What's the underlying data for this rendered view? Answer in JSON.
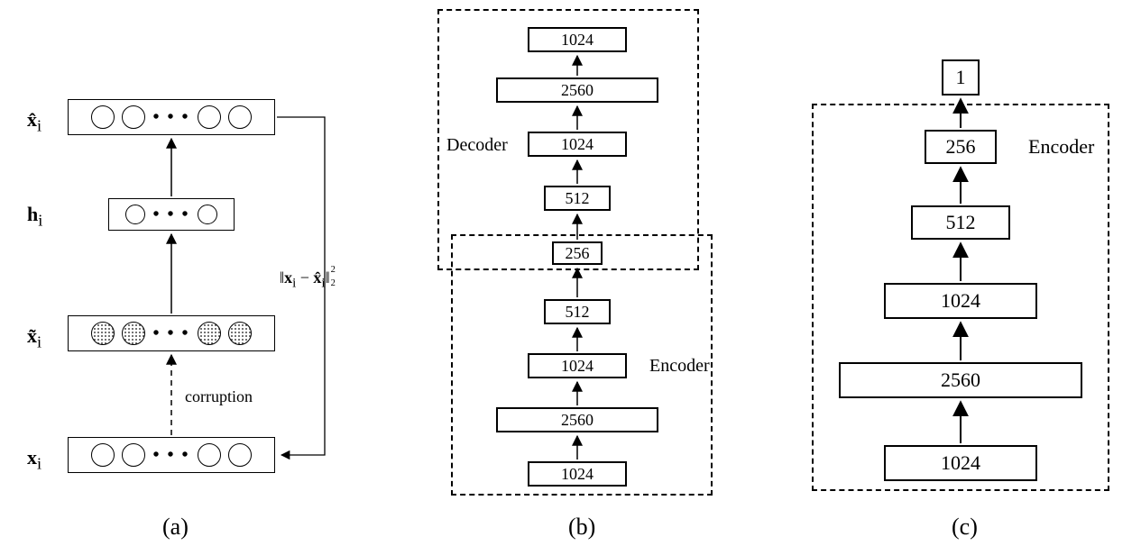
{
  "captions": {
    "a": "(a)",
    "b": "(b)",
    "c": "(c)"
  },
  "panel_a": {
    "label_x": "x",
    "label_xtilde": "x̃",
    "label_h": "h",
    "label_xhat": "x̂",
    "subscript": "i",
    "corruption": "corruption",
    "loss_prefix": "‖",
    "loss_mid": " − ",
    "loss_suffix": "‖",
    "loss_sub": "2",
    "loss_sup": "2",
    "dots": "• • •"
  },
  "panel_b": {
    "encoder_label": "Encoder",
    "decoder_label": "Decoder",
    "layers_bottom_to_top": [
      "1024",
      "2560",
      "1024",
      "512",
      "256",
      "512",
      "1024",
      "2560",
      "1024"
    ]
  },
  "panel_c": {
    "encoder_label": "Encoder",
    "output": "1",
    "layers_bottom_to_top": [
      "1024",
      "2560",
      "1024",
      "512",
      "256"
    ]
  },
  "chart_data": {
    "type": "diagram",
    "panels": [
      {
        "id": "a",
        "description": "Denoising autoencoder schematic: input x_i is corrupted to x̃_i, encoded to h_i, decoded to x̂_i; trained with reconstruction loss ‖x_i − x̂_i‖_2^2."
      },
      {
        "id": "b",
        "description": "Stacked encoder-decoder with layer widths 1024→2560→1024→512→256 (encoder) then 512→1024→2560→1024 (decoder)."
      },
      {
        "id": "c",
        "description": "Encoder (1024→2560→1024→512→256) followed by a single-unit output layer."
      }
    ]
  }
}
